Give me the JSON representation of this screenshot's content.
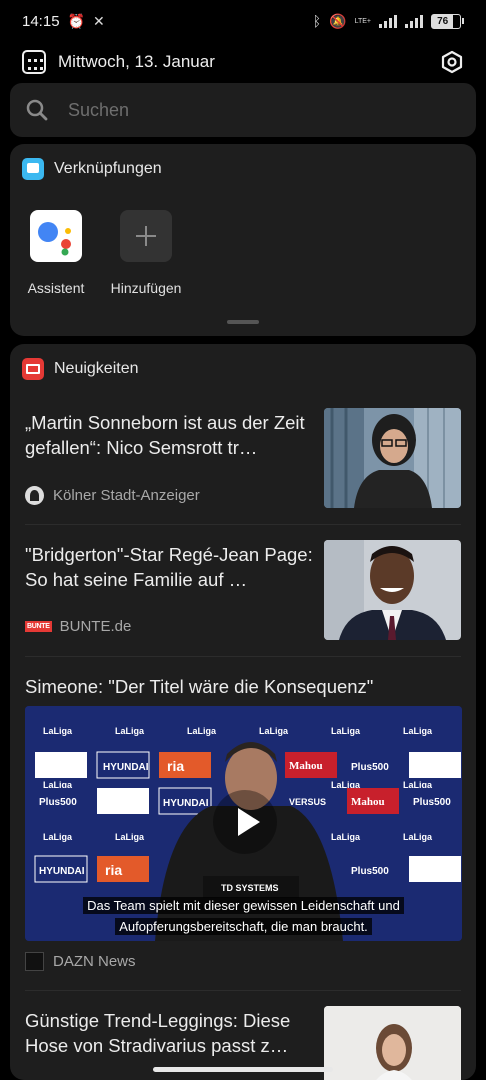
{
  "status_bar": {
    "time": "14:15",
    "network_label": "LTE+",
    "battery_level": "76"
  },
  "date_bar": {
    "date": "Mittwoch, 13. Januar"
  },
  "search": {
    "placeholder": "Suchen"
  },
  "shortcuts": {
    "title": "Verknüpfungen",
    "items": [
      {
        "label": "Assistent",
        "icon": "google-assistant-icon"
      },
      {
        "label": "Hinzufügen",
        "icon": "plus-icon"
      }
    ]
  },
  "news": {
    "title": "Neuigkeiten",
    "articles": [
      {
        "title": "„Martin Sonneborn ist aus der Zeit gefallen“: Nico Semsrott tr…",
        "source": "Kölner Stadt-Anzeiger"
      },
      {
        "title": "\"Bridgerton\"-Star Regé-Jean Page: So hat seine Familie auf …",
        "source": "BUNTE.de",
        "source_logo_text": "BUNTE"
      },
      {
        "title": "Simeone: \"Der Titel wäre die Konsequenz\"",
        "source": "DAZN News",
        "video": {
          "subtitle_line1": "Das Team spielt mit dieser gewissen Leidenschaft und",
          "subtitle_line2": "Aufopferungsbereitschaft, die man braucht.",
          "sponsor_logos": [
            "LaLiga",
            "HYUNDAI",
            "ria",
            "Mahou",
            "Plus500",
            "VERSUS"
          ],
          "desk_sign": "TD SYSTEMS"
        }
      },
      {
        "title": "Günstige Trend-Leggings: Diese Hose von Stradivarius passt z…",
        "source": ""
      }
    ]
  },
  "colors": {
    "background": "#000000",
    "card": "#1e1e1e",
    "shortcuts_icon": "#3bb8f0",
    "news_icon": "#e53935",
    "laliga_backdrop": "#1a2a6e"
  }
}
